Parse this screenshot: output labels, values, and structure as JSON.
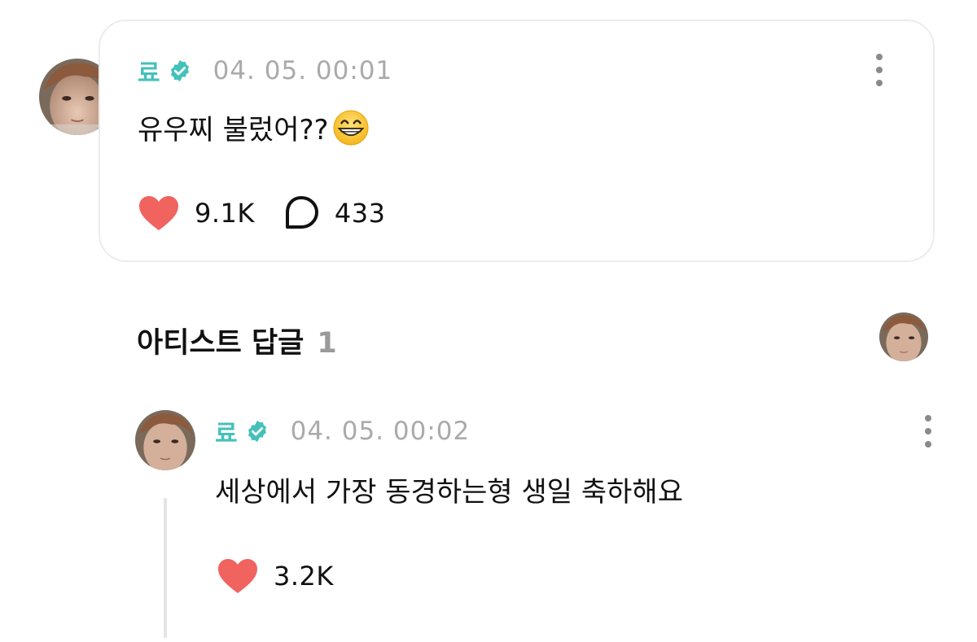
{
  "post": {
    "author": "료",
    "timestamp": "04. 05. 00:01",
    "text": "유우찌 불렀어??",
    "emoji": "grinning-face-with-smiling-eyes",
    "likes": "9.1K",
    "comments": "433"
  },
  "section": {
    "title": "아티스트 답글",
    "count": "1"
  },
  "reply": {
    "author": "료",
    "timestamp": "04. 05. 00:02",
    "text": "세상에서 가장 동경하는형 생일 축하해요",
    "likes": "3.2K"
  },
  "colors": {
    "author_name": "#43c1ba",
    "verified_badge": "#43c1ba",
    "heart": "#f0635f",
    "timestamp": "#aaaaaa",
    "card_border": "#ececec"
  },
  "icons": [
    "verified-badge-icon",
    "more-vertical-icon",
    "heart-icon",
    "comment-bubble-icon"
  ]
}
